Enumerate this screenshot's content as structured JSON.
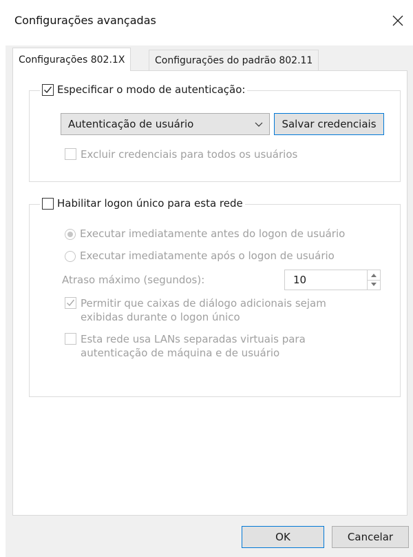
{
  "window": {
    "title": "Configurações avançadas",
    "close_icon": "close-icon"
  },
  "tabs": [
    {
      "label": "Configurações 802.1X",
      "active": true
    },
    {
      "label": "Configurações do padrão 802.11",
      "active": false
    }
  ],
  "auth_group": {
    "specify_mode_label": "Especificar o modo de autenticação:",
    "specify_mode_checked": true,
    "auth_mode_selected": "Autenticação de usuário",
    "save_credentials_label": "Salvar credenciais",
    "delete_credentials_label": "Excluir credenciais para todos os usuários",
    "delete_credentials_checked": false
  },
  "sso_group": {
    "enable_sso_label": "Habilitar logon único para esta rede",
    "enable_sso_checked": false,
    "before_logon_label": "Executar imediatamente antes do logon de usuário",
    "before_logon_selected": true,
    "after_logon_label": "Executar imediatamente após o logon de usuário",
    "after_logon_selected": false,
    "max_delay_label": "Atraso máximo (segundos):",
    "max_delay_value": "10",
    "allow_dialogs_label": "Permitir que caixas de diálogo adicionais sejam exibidas durante o logon único",
    "allow_dialogs_checked": true,
    "virtual_lans_label": "Esta rede usa LANs separadas virtuais para autenticação de máquina e de usuário",
    "virtual_lans_checked": false
  },
  "footer": {
    "ok_label": "OK",
    "cancel_label": "Cancelar"
  },
  "colors": {
    "accent": "#0078d7",
    "disabled_text": "#a0a0a0"
  }
}
